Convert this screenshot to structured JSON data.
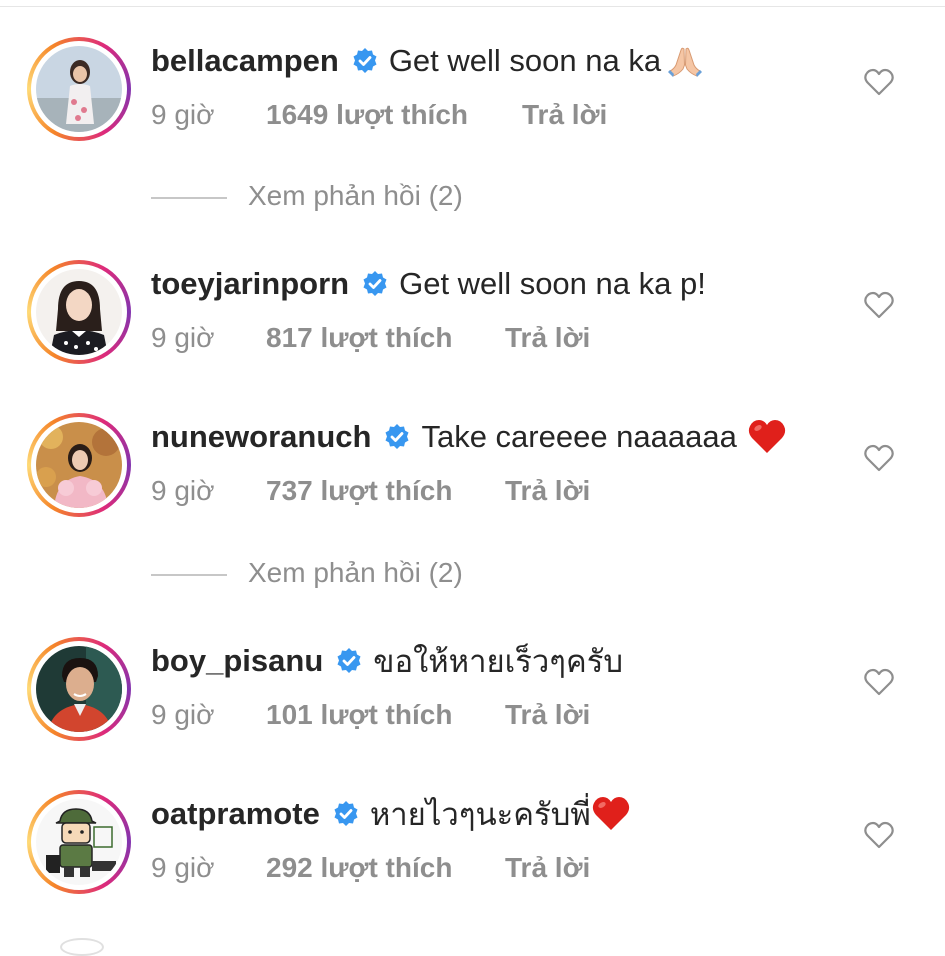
{
  "comments": [
    {
      "username": "bellacampen",
      "text": "Get well soon na ka",
      "emoji": "folded-hands",
      "time": "9 giờ",
      "likes": "1649 lượt thích",
      "reply": "Trả lời"
    },
    {
      "username": "toeyjarinporn",
      "text": "Get well soon na ka p!",
      "time": "9 giờ",
      "likes": "817 lượt thích",
      "reply": "Trả lời"
    },
    {
      "username": "nuneworanuch",
      "text": "Take careeee naaaaaa",
      "emoji": "red-heart",
      "time": "9 giờ",
      "likes": "737 lượt thích",
      "reply": "Trả lời"
    },
    {
      "username": "boy_pisanu",
      "text": "ขอให้หายเร็วๆครับ",
      "time": "9 giờ",
      "likes": "101 lượt thích",
      "reply": "Trả lời"
    },
    {
      "username": "oatpramote",
      "text": "หายไวๆนะครับพี่",
      "emoji": "red-heart",
      "time": "9 giờ",
      "likes": "292 lượt thích",
      "reply": "Trả lời"
    }
  ],
  "view_replies": [
    {
      "label": "Xem phản hồi (2)"
    },
    {
      "label": "Xem phản hồi (2)"
    }
  ],
  "icons": {
    "verified": "verified-badge-icon",
    "like": "heart-outline-icon"
  },
  "colors": {
    "verified_blue": "#3897f0",
    "muted_text": "#8e8e8e",
    "primary_text": "#262626",
    "heart_red": "#e0201b"
  }
}
